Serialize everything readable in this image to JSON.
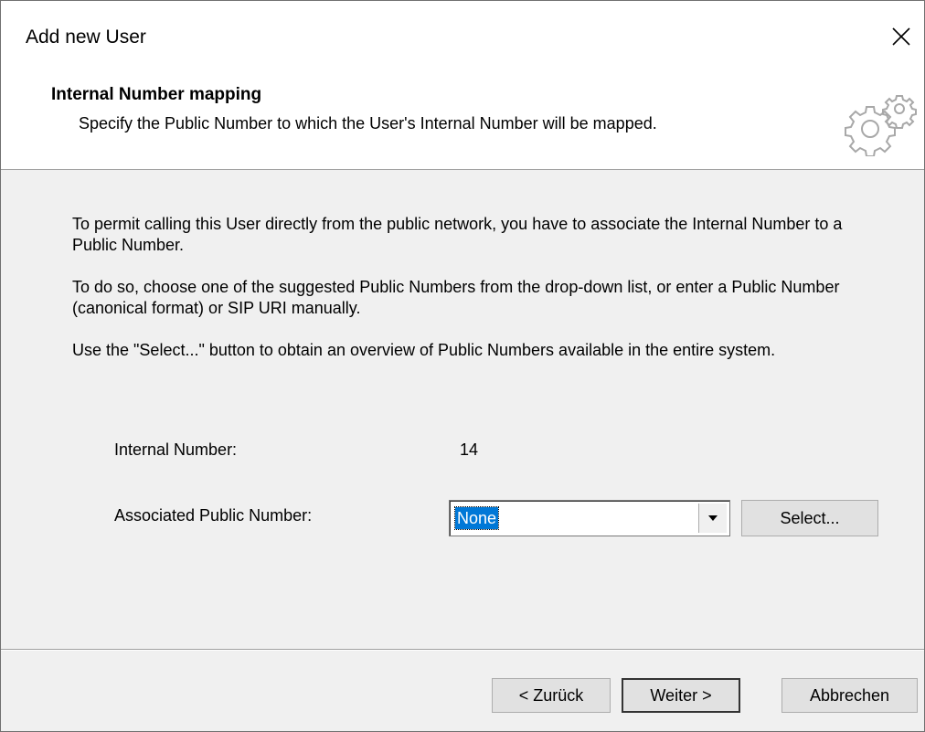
{
  "window": {
    "title": "Add new User",
    "close_icon": "close-icon"
  },
  "header": {
    "title": "Internal Number mapping",
    "subtitle": "Specify the Public Number to which the User's Internal  Number will be mapped.",
    "icon": "gears-icon"
  },
  "content": {
    "paragraphs": [
      "To permit calling this User directly from the public network, you have to associate the Internal Number to a Public Number.",
      "To do so, choose one of the suggested Public Numbers from the drop-down list, or enter a Public Number (canonical format) or SIP URI manually.",
      "Use the \"Select...\" button to obtain an overview of Public Numbers available in the entire system."
    ],
    "internal_number_label": "Internal Number:",
    "internal_number_value": "14",
    "associated_label": "Associated Public Number:",
    "associated_value": "None",
    "select_button": "Select..."
  },
  "footer": {
    "back_button": "< Zurück",
    "next_button": "Weiter >",
    "cancel_button": "Abbrechen"
  },
  "colors": {
    "selection": "#0078d7",
    "button_face": "#e1e1e1",
    "dialog_bg": "#f0f0f0"
  }
}
